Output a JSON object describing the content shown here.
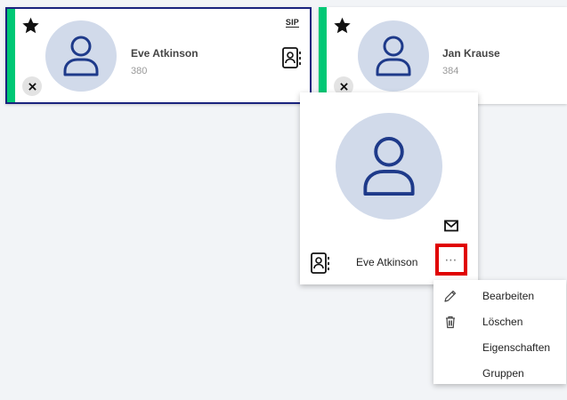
{
  "cards": [
    {
      "name": "Eve Atkinson",
      "extension": "380",
      "sip_label": "SIP",
      "status_color": "#00c875"
    },
    {
      "name": "Jan Krause",
      "extension": "384",
      "status_color": "#00c875"
    }
  ],
  "popup": {
    "name": "Eve Atkinson",
    "more_label": "⋯"
  },
  "context_menu": {
    "items": [
      {
        "label": "Bearbeiten",
        "icon": "pencil-icon"
      },
      {
        "label": "Löschen",
        "icon": "trash-icon"
      },
      {
        "label": "Eigenschaften",
        "icon": ""
      },
      {
        "label": "Gruppen",
        "icon": ""
      }
    ]
  },
  "colors": {
    "accent_border": "#1a237e",
    "avatar_bg": "#d1daea",
    "avatar_icon": "#1e3a8a",
    "highlight": "#e00000"
  }
}
